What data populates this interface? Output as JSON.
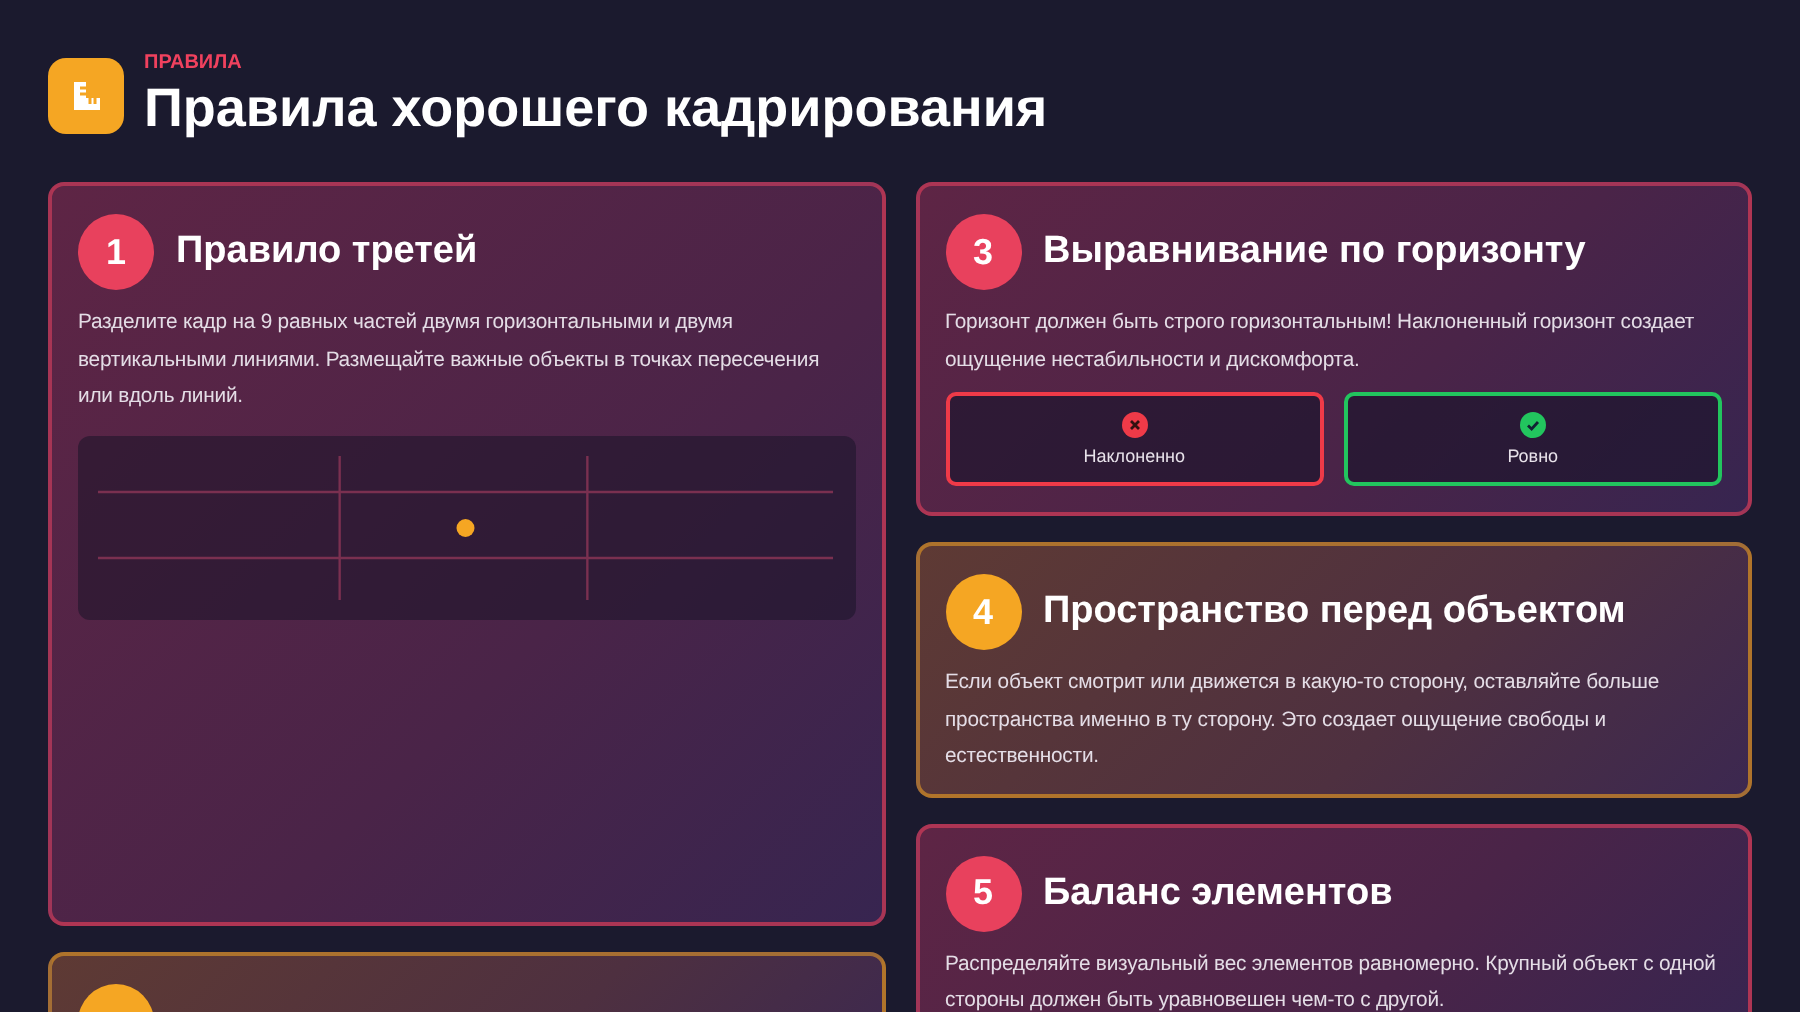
{
  "header": {
    "eyebrow": "ПРАВИЛА",
    "title": "Правила хорошего кадрирования"
  },
  "columns": [
    [
      {
        "color": "#e8415d",
        "kind": "grid",
        "number": "1",
        "title": "Правило третей",
        "text": "Разделите кадр на 9 равных частей двумя горизонтальными и двумя вертикальными линиями. Размещайте важные объекты в точках пересечения или вдоль линий."
      },
      {
        "color": "#f5a623",
        "kind": "plain"
      }
    ],
    [
      {
        "color": "#e8415d",
        "kind": "examples",
        "number": "3",
        "title": "Выравнивание по горизонту",
        "text": "Горизонт должен быть строго горизонтальным! Наклоненный горизонт создает ощущение нестабильности и дискомфорта.",
        "examples": [
          {
            "kind": "bad",
            "label": "Наклоненно"
          },
          {
            "kind": "good",
            "label": "Ровно"
          }
        ]
      },
      {
        "color": "#f5a623",
        "kind": "plain",
        "number": "4",
        "title": "Пространство перед объектом",
        "text": "Если объект смотрит или движется в какую-то сторону, оставляйте больше пространства именно в ту сторону. Это создает ощущение свободы и естественности."
      },
      {
        "color": "#e8415d",
        "kind": "plain",
        "number": "5",
        "title": "Баланс элементов",
        "text": "Распределяйте визуальный вес элементов равномерно. Крупный объект с одной стороны должен быть уравновешен чем-то с другой."
      }
    ]
  ]
}
